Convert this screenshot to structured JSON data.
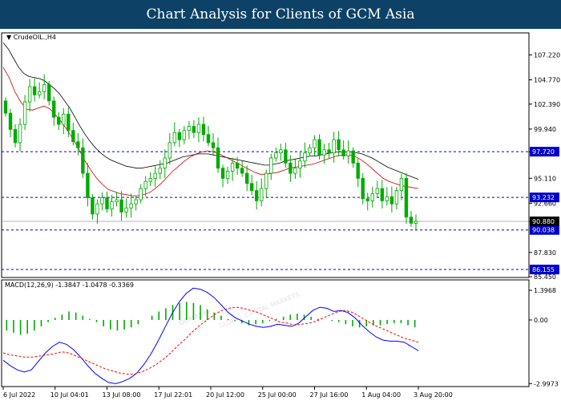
{
  "page_title": "Chart Analysis for Clients of GCM Asia",
  "symbol_label": "CrudeOIL.,H4",
  "watermark": {
    "text": "GCMASIA",
    "sub": "GLOBAL CAPITAL MARKETS"
  },
  "colors": {
    "title_bg": "#0d4166",
    "candle": "#00aa00",
    "ma_fast": "#cc0000",
    "ma_slow": "#000000",
    "level_line": "#0000cc",
    "level_label_bg": "#0000cc",
    "price_label_bg": "#000000",
    "macd_line": "#0000ff",
    "macd_signal": "#ff0000",
    "macd_hist": "#00aa00"
  },
  "chart_data": [
    {
      "type": "candlestick",
      "title": "CrudeOIL.,H4",
      "y_ticks": [
        "107.220",
        "104.770",
        "102.390",
        "99.940",
        "97.720",
        "95.110",
        "92.660",
        "90.880",
        "87.830",
        "85.450"
      ],
      "ylim": [
        85.45,
        109.3
      ],
      "levels": [
        {
          "label": "97.720",
          "value": 97.72
        },
        {
          "label": "93.232",
          "value": 93.232
        },
        {
          "label": "90.038",
          "value": 90.038
        },
        {
          "label": "86.155",
          "value": 86.155
        }
      ],
      "current_price": {
        "label": "90.880",
        "value": 90.88
      },
      "x_ticks": [
        "6 Jul 2022",
        "10 Jul 04:01",
        "13 Jul 08:00",
        "17 Jul 22:01",
        "20 Jul 12:00",
        "25 Jul 00:00",
        "27 Jul 16:00",
        "1 Aug 04:00",
        "3 Aug 20:00"
      ],
      "closes": [
        101.5,
        99.9,
        98.6,
        100.4,
        102.6,
        104.1,
        103.3,
        103.6,
        104.3,
        102.7,
        101.1,
        100.4,
        101.4,
        99.8,
        98.7,
        98.1,
        95.6,
        93.2,
        91.6,
        92.6,
        93.2,
        92.1,
        92.8,
        93.0,
        91.8,
        92.2,
        92.6,
        93.0,
        94.1,
        94.8,
        95.1,
        95.6,
        96.1,
        97.1,
        98.6,
        99.6,
        98.9,
        99.8,
        100.2,
        99.6,
        100.4,
        99.4,
        98.6,
        98.1,
        96.1,
        95.1,
        95.8,
        96.6,
        96.1,
        95.6,
        94.6,
        93.9,
        92.9,
        94.1,
        95.6,
        97.1,
        97.6,
        97.9,
        96.6,
        95.6,
        96.1,
        96.8,
        97.6,
        98.1,
        98.9,
        97.4,
        97.9,
        97.6,
        98.9,
        97.9,
        97.3,
        97.8,
        96.6,
        95.1,
        93.1,
        92.9,
        93.6,
        94.1,
        92.9,
        93.3,
        92.6,
        93.9,
        95.1,
        91.3,
        90.7,
        90.88
      ],
      "series": [
        {
          "name": "",
          "values": [
            108.4,
            107.8,
            106.9,
            106.0,
            105.4,
            105.1,
            105.0,
            104.9,
            104.7,
            104.3,
            103.9,
            103.4,
            102.7,
            102.0,
            101.1,
            100.2,
            99.4,
            98.7,
            98.1,
            97.6,
            97.2,
            96.9,
            96.7,
            96.5,
            96.3,
            96.2,
            96.1,
            96.1,
            96.2,
            96.3,
            96.4,
            96.5,
            96.6,
            96.8,
            97.0,
            97.2,
            97.3,
            97.4,
            97.5,
            97.5,
            97.5,
            97.4,
            97.3,
            97.2,
            97.1,
            97.0,
            96.9,
            96.8,
            96.7,
            96.6,
            96.5,
            96.4,
            96.4,
            96.5,
            96.6,
            96.8,
            96.9,
            97.0,
            97.1,
            97.2,
            97.3,
            97.3,
            97.4,
            97.5,
            97.6,
            97.7,
            97.7,
            97.7,
            97.7,
            97.6,
            97.5,
            97.3,
            97.1,
            96.8,
            96.5,
            96.2,
            96.0,
            95.8,
            95.6,
            95.4,
            95.2,
            95.0
          ]
        },
        {
          "name": "",
          "values": [
            106.0,
            105.0,
            103.6,
            102.6,
            101.9,
            101.8,
            102.0,
            102.2,
            101.9,
            101.3,
            100.6,
            99.8,
            98.9,
            97.9,
            96.8,
            95.9,
            95.1,
            94.5,
            94.0,
            93.8,
            93.6,
            93.5,
            93.4,
            93.4,
            93.5,
            93.7,
            94.1,
            94.6,
            95.2,
            95.8,
            96.3,
            96.8,
            97.2,
            97.5,
            97.7,
            97.8,
            97.7,
            97.5,
            97.2,
            96.9,
            96.6,
            96.3,
            96.0,
            95.7,
            95.5,
            95.5,
            95.6,
            95.7,
            95.9,
            96.1,
            96.2,
            96.3,
            96.4,
            96.5,
            96.7,
            96.9,
            97.1,
            97.3,
            97.4,
            97.4,
            97.3,
            97.0,
            96.6,
            96.1,
            95.6,
            95.1,
            94.8,
            94.6,
            94.4,
            94.3,
            94.2,
            94.1
          ]
        }
      ]
    },
    {
      "type": "line",
      "title": "MACD(12,26,9) -1.3847 -1.0478 -0.3369",
      "y_ticks": [
        "1.3968",
        "0.00",
        "-2.9973"
      ],
      "ylim": [
        -3.1,
        1.85
      ],
      "series": [
        {
          "name": "MACD",
          "values": [
            -1.9,
            -2.15,
            -2.35,
            -2.45,
            -2.35,
            -1.95,
            -1.55,
            -1.25,
            -1.05,
            -1.15,
            -1.4,
            -1.75,
            -2.15,
            -2.5,
            -2.75,
            -2.95,
            -3.0,
            -2.9,
            -2.75,
            -2.5,
            -2.1,
            -1.6,
            -1.0,
            -0.35,
            0.3,
            0.85,
            1.25,
            1.5,
            1.45,
            1.3,
            1.05,
            0.7,
            0.35,
            0.1,
            -0.05,
            -0.2,
            -0.3,
            -0.35,
            -0.3,
            -0.2,
            -0.25,
            -0.3,
            -0.15,
            0.15,
            0.45,
            0.6,
            0.55,
            0.4,
            0.45,
            0.35,
            0.1,
            -0.25,
            -0.55,
            -0.8,
            -0.95,
            -1.0,
            -1.0,
            -1.05,
            -1.25,
            -1.45
          ]
        },
        {
          "name": "Signal",
          "values": [
            -1.55,
            -1.65,
            -1.7,
            -1.75,
            -1.75,
            -1.7,
            -1.65,
            -1.6,
            -1.5,
            -1.55,
            -1.7,
            -1.85,
            -2.0,
            -2.15,
            -2.3,
            -2.4,
            -2.5,
            -2.55,
            -2.55,
            -2.45,
            -2.3,
            -2.1,
            -1.85,
            -1.55,
            -1.2,
            -0.9,
            -0.55,
            -0.25,
            0.0,
            0.25,
            0.45,
            0.55,
            0.6,
            0.55,
            0.45,
            0.35,
            0.2,
            0.05,
            -0.1,
            -0.15,
            -0.25,
            -0.2,
            -0.15,
            -0.05,
            0.1,
            0.25,
            0.4,
            0.45,
            0.35,
            0.15,
            -0.05,
            -0.25,
            -0.4,
            -0.55,
            -0.7,
            -0.85,
            -0.95,
            -1.05
          ]
        },
        {
          "name": "Histogram",
          "values": [
            -0.5,
            -0.6,
            -0.7,
            -0.65,
            -0.5,
            -0.3,
            -0.1,
            0.1,
            0.25,
            0.4,
            0.35,
            0.2,
            0.05,
            -0.1,
            -0.3,
            -0.45,
            -0.5,
            -0.45,
            -0.35,
            -0.2,
            0.0,
            0.2,
            0.4,
            0.55,
            0.7,
            0.8,
            0.85,
            0.8,
            0.7,
            0.5,
            0.35,
            0.2,
            0.05,
            -0.05,
            -0.15,
            -0.25,
            -0.2,
            -0.15,
            -0.05,
            0.05,
            0.15,
            0.25,
            0.3,
            0.25,
            0.15,
            0.05,
            0.0,
            -0.05,
            -0.1,
            -0.2,
            -0.3,
            -0.35,
            -0.3,
            -0.25,
            -0.25,
            -0.2,
            -0.15,
            -0.15,
            -0.25,
            -0.35
          ]
        }
      ]
    }
  ]
}
